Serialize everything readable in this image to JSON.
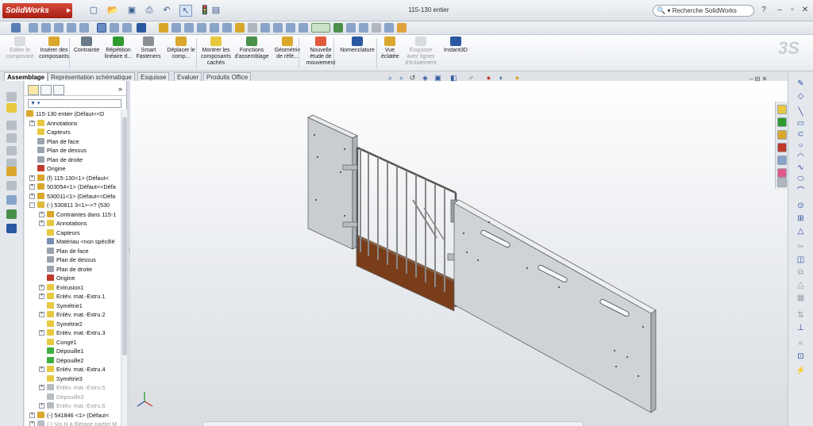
{
  "app": {
    "logo": "SolidWorks",
    "document_title": "115-130 entier"
  },
  "search": {
    "label": "Recherche SolidWorks"
  },
  "ribbon": {
    "buttons": [
      {
        "label": "Editer le composant",
        "disabled": true
      },
      {
        "label": "Insérer des composants"
      },
      {
        "label": "Contrainte"
      },
      {
        "label": "Répétition linéaire d..."
      },
      {
        "label": "Smart Fasteners"
      },
      {
        "label": "Déplacer le comp..."
      },
      {
        "label": "Montrer les composants cachés"
      },
      {
        "label": "Fonctions d'assemblage"
      },
      {
        "label": "Géométrie de réfé..."
      },
      {
        "label": "Nouvelle étude de mouvement"
      },
      {
        "label": "Nomenclature"
      },
      {
        "label": "Vue éclatée"
      },
      {
        "label": "Esquisse avec lignes d'éclatement",
        "disabled": true
      },
      {
        "label": "Instant3D"
      }
    ]
  },
  "tabs": [
    "Assemblage",
    "Représentation schématique",
    "Esquisse",
    "Evaluer",
    "Produits Office"
  ],
  "tree": [
    {
      "label": "115-130 entier  (Défaut<<D",
      "indent": 0,
      "icon": "assembly-icon",
      "color": "#d9a72b"
    },
    {
      "label": "Annotations",
      "indent": 1,
      "icon": "annotations-icon",
      "color": "#e8c840",
      "exp": "+"
    },
    {
      "label": "Capteurs",
      "indent": 1,
      "icon": "sensor-icon",
      "color": "#e8c840"
    },
    {
      "label": "Plan de face",
      "indent": 1,
      "icon": "plane-icon",
      "color": "#9aa3ad"
    },
    {
      "label": "Plan de dessus",
      "indent": 1,
      "icon": "plane-icon",
      "color": "#9aa3ad"
    },
    {
      "label": "Plan de droite",
      "indent": 1,
      "icon": "plane-icon",
      "color": "#9aa3ad"
    },
    {
      "label": "Origine",
      "indent": 1,
      "icon": "origin-icon",
      "color": "#c0392b"
    },
    {
      "label": "(f) 115-130<1> (Défaut<",
      "indent": 1,
      "icon": "subassembly-icon",
      "color": "#d9a72b",
      "exp": "+"
    },
    {
      "label": "503054<1> (Défaut<<Défa",
      "indent": 1,
      "icon": "subassembly-icon",
      "color": "#d9a72b",
      "exp": "+"
    },
    {
      "label": "530011<1> (Défaut<<Défa",
      "indent": 1,
      "icon": "subassembly-icon",
      "color": "#d9a72b",
      "exp": "+"
    },
    {
      "label": "(-) 530811 3<1>->? (530",
      "indent": 1,
      "icon": "part-icon",
      "color": "#e0b93a",
      "exp": "-"
    },
    {
      "label": "Contraintes dans 115-1",
      "indent": 2,
      "icon": "mates-icon",
      "color": "#d9a72b",
      "exp": "+"
    },
    {
      "label": "Annotations",
      "indent": 2,
      "icon": "annotations-icon",
      "color": "#e8c840",
      "exp": "+"
    },
    {
      "label": "Capteurs",
      "indent": 2,
      "icon": "sensor-icon",
      "color": "#e8c840"
    },
    {
      "label": "Matériau <non spécifié",
      "indent": 2,
      "icon": "material-icon",
      "color": "#7a8fb0"
    },
    {
      "label": "Plan de face",
      "indent": 2,
      "icon": "plane-icon",
      "color": "#9aa3ad"
    },
    {
      "label": "Plan de dessus",
      "indent": 2,
      "icon": "plane-icon",
      "color": "#9aa3ad"
    },
    {
      "label": "Plan de droite",
      "indent": 2,
      "icon": "plane-icon",
      "color": "#9aa3ad"
    },
    {
      "label": "Origine",
      "indent": 2,
      "icon": "origin-icon",
      "color": "#c0392b"
    },
    {
      "label": "Extrusion1",
      "indent": 2,
      "icon": "extrude-icon",
      "color": "#e8c840",
      "exp": "+"
    },
    {
      "label": "Enlév. mat.-Extru.1",
      "indent": 2,
      "icon": "cut-extrude-icon",
      "color": "#e8c840",
      "exp": "+"
    },
    {
      "label": "Symétrie1",
      "indent": 2,
      "icon": "mirror-icon",
      "color": "#e8c840"
    },
    {
      "label": "Enlév. mat.-Extru.2",
      "indent": 2,
      "icon": "cut-extrude-icon",
      "color": "#e8c840",
      "exp": "+"
    },
    {
      "label": "Symétrie2",
      "indent": 2,
      "icon": "mirror-icon",
      "color": "#e8c840"
    },
    {
      "label": "Enlév. mat.-Extru.3",
      "indent": 2,
      "icon": "cut-extrude-icon",
      "color": "#e8c840",
      "exp": "+"
    },
    {
      "label": "Congé1",
      "indent": 2,
      "icon": "fillet-icon",
      "color": "#e8c840"
    },
    {
      "label": "Dépouille1",
      "indent": 2,
      "icon": "draft-icon",
      "color": "#3fae3f"
    },
    {
      "label": "Dépouille2",
      "indent": 2,
      "icon": "draft-icon",
      "color": "#3fae3f"
    },
    {
      "label": "Enlév. mat.-Extru.4",
      "indent": 2,
      "icon": "cut-extrude-icon",
      "color": "#e8c840",
      "exp": "+"
    },
    {
      "label": "Symétrie3",
      "indent": 2,
      "icon": "mirror-icon",
      "color": "#e8c840"
    },
    {
      "label": "Enlév. mat.-Extru.5",
      "indent": 2,
      "icon": "cut-extrude-icon",
      "color": "#b8bcc2",
      "exp": "+",
      "grey": true
    },
    {
      "label": "Dépouille3",
      "indent": 2,
      "icon": "draft-icon",
      "color": "#b8bcc2",
      "grey": true
    },
    {
      "label": "Enlév. mat.-Extru.6",
      "indent": 2,
      "icon": "cut-extrude-icon",
      "color": "#b8bcc2",
      "exp": "+",
      "grey": true
    },
    {
      "label": "(-) 541846 <1> (Défaut<",
      "indent": 1,
      "icon": "subassembly-icon",
      "color": "#d9a72b",
      "exp": "+"
    },
    {
      "label": "(-) Vis H à filetage partiel M",
      "indent": 1,
      "icon": "part-icon",
      "color": "#b8bcc2",
      "exp": "+",
      "grey": true
    }
  ],
  "colors": {
    "accent": "#2b58a0",
    "wood": "#7a3d1a",
    "logo_red": "#c0392b"
  }
}
